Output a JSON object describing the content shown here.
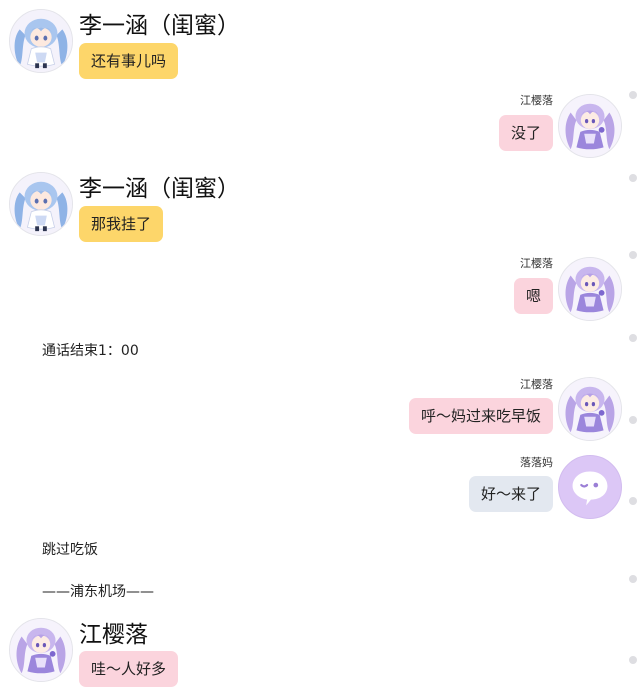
{
  "messages": [
    {
      "sender": "李一涵（闺蜜）",
      "text": "还有事儿吗"
    },
    {
      "sender": "江樱落",
      "text": "没了"
    },
    {
      "sender": "李一涵（闺蜜）",
      "text": "那我挂了"
    },
    {
      "sender": "江樱落",
      "text": "嗯"
    },
    {
      "system": "通话结束1：00"
    },
    {
      "sender": "江樱落",
      "text": "呼～妈过来吃早饭"
    },
    {
      "sender": "落落妈",
      "text": "好～来了"
    },
    {
      "system": "跳过吃饭"
    },
    {
      "system": "——浦东机场——"
    },
    {
      "sender": "江樱落",
      "text": "哇～人好多"
    }
  ],
  "colors": {
    "yellow_bubble": "#fdd66a",
    "pink_bubble": "#fbd4dd",
    "gray_bubble": "#e3e8f0",
    "mom_avatar": "#dcc7f6"
  },
  "icons": {
    "girl_avatar": "anime-girl-avatar-icon",
    "mom_avatar": "chat-bubble-icon"
  }
}
